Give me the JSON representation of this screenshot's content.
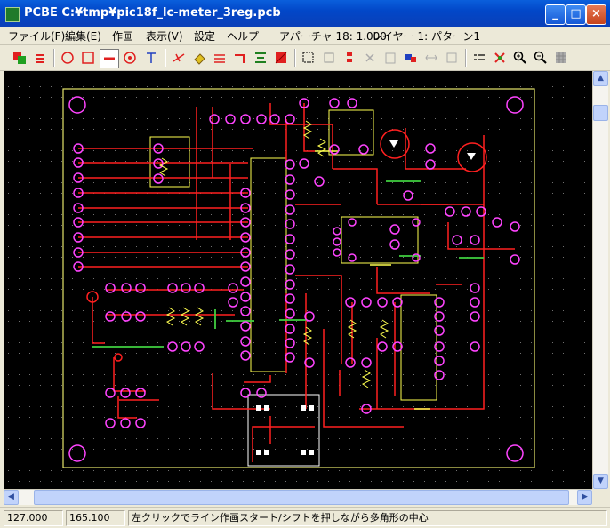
{
  "window": {
    "title": "PCBE  C:¥tmp¥pic18f_lc-meter_3reg.pcb",
    "minimize": "_",
    "maximize": "□",
    "close": "×"
  },
  "menu": {
    "items": [
      "ファイル(F)",
      "編集(E)",
      "作画",
      "表示(V)",
      "設定",
      "ヘルプ"
    ],
    "aperture": "アパーチャ 18: 1.000",
    "layer": "レイヤー 1: パターン1"
  },
  "toolbar": {
    "icons": [
      "layer-set-icon",
      "layer-toggle-icon",
      "circle-tool-icon",
      "rectangle-tool-icon",
      "line-tool-icon",
      "donut-tool-icon",
      "text-tool-icon",
      "move-point-icon",
      "eraser-icon",
      "parallel-lines-icon",
      "corner-line-icon",
      "align-icon",
      "fill-icon",
      "select-icon",
      "copy-icon",
      "arrange-icon",
      "cut-icon",
      "paste-icon",
      "swap-icon",
      "mirror-icon",
      "rotate-icon",
      "measure-icon",
      "net-icon",
      "zoom-in-icon",
      "zoom-out-icon",
      "grid-icon"
    ],
    "active": "line-tool-icon"
  },
  "statusbar": {
    "x": "127.000",
    "y": "165.100",
    "message": "左クリックでライン作画スタート/シフトを押しながら多角形の中心"
  },
  "colors": {
    "canvas": "#000000",
    "trace": "#ff2020",
    "pad": "#ff44ff",
    "outline": "#e6e66a",
    "silk": "#ffffff",
    "yellow_trace": "#ffff50",
    "green_trace": "#40d040"
  }
}
